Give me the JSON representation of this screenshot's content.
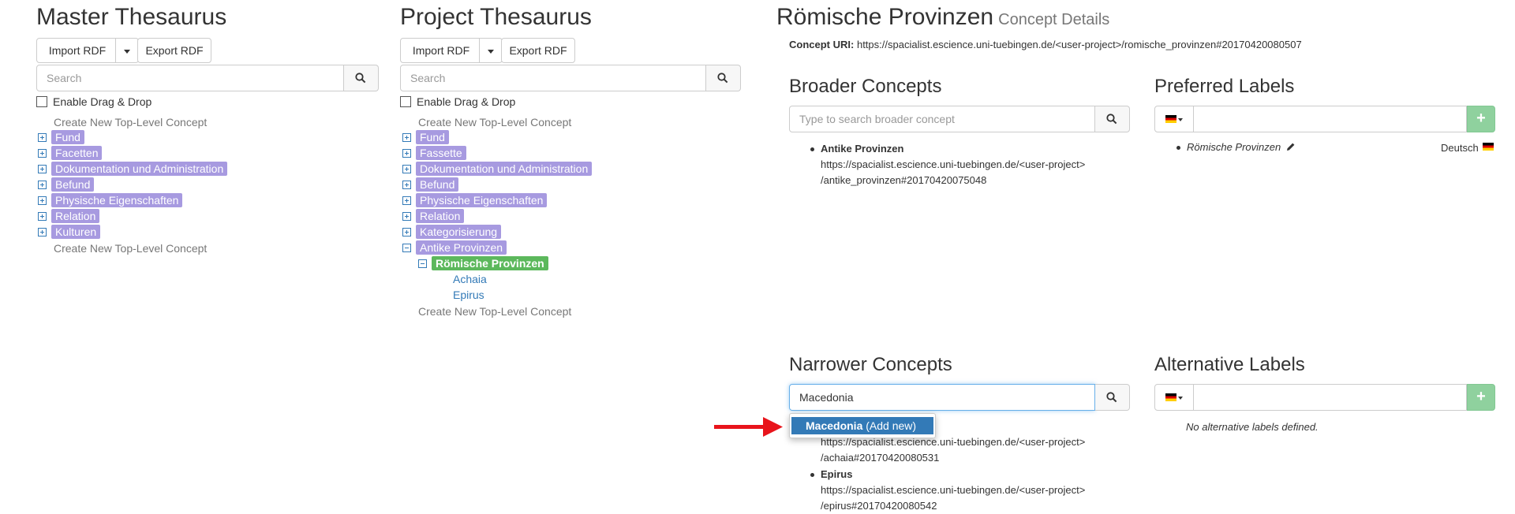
{
  "master": {
    "title": "Master Thesaurus",
    "import_label": "Import RDF",
    "export_label": "Export RDF",
    "search_placeholder": "Search",
    "drag_drop_label": "Enable Drag & Drop",
    "create_top_label": "Create New Top-Level Concept",
    "concepts": [
      "Fund",
      "Facetten",
      "Dokumentation und Administration",
      "Befund",
      "Physische Eigenschaften",
      "Relation",
      "Kulturen"
    ],
    "create_bottom_label": "Create New Top-Level Concept"
  },
  "project": {
    "title": "Project Thesaurus",
    "import_label": "Import RDF",
    "export_label": "Export RDF",
    "search_placeholder": "Search",
    "drag_drop_label": "Enable Drag & Drop",
    "create_top_label": "Create New Top-Level Concept",
    "concepts": [
      "Fund",
      "Fassette",
      "Dokumentation und Administration",
      "Befund",
      "Physische Eigenschaften",
      "Relation",
      "Kategorisierung",
      "Antike Provinzen"
    ],
    "selected_concept": "Römische Provinzen",
    "children": [
      "Achaia",
      "Epirus"
    ],
    "create_bottom_label": "Create New Top-Level Concept"
  },
  "details": {
    "title": "Römische Provinzen",
    "subtitle": "Concept Details",
    "uri_label": "Concept URI:",
    "uri_value": "https://spacialist.escience.uni-tuebingen.de/<user-project>/romische_provinzen#20170420080507",
    "broader": {
      "title": "Broader Concepts",
      "search_placeholder": "Type to search broader concept",
      "items": [
        {
          "name": "Antike Provinzen",
          "uri_line1": "https://spacialist.escience.uni-tuebingen.de/<user-project>",
          "uri_line2": "/antike_provinzen#20170420075048"
        }
      ]
    },
    "preferred": {
      "title": "Preferred Labels",
      "items": [
        {
          "label": "Römische Provinzen",
          "language": "Deutsch"
        }
      ]
    },
    "narrower": {
      "title": "Narrower Concepts",
      "search_value": "Macedonia",
      "suggestion_bold": "Macedonia",
      "suggestion_suffix": "(Add new)",
      "partial_uri_line1": "https://spacialist.escience.uni-tuebingen.de/<user-project>",
      "partial_uri_line2": "/achaia#20170420080531",
      "items": [
        {
          "name": "Epirus",
          "uri_line1": "https://spacialist.escience.uni-tuebingen.de/<user-project>",
          "uri_line2": "/epirus#20170420080542"
        }
      ]
    },
    "alternative": {
      "title": "Alternative Labels",
      "empty_text": "No alternative labels defined."
    }
  },
  "colors": {
    "concept_tag": "#a79ae0",
    "selected_tag": "#5cb85c",
    "link": "#337ab7",
    "add_button": "#8fd19e",
    "annotation_arrow": "#e8141b"
  }
}
